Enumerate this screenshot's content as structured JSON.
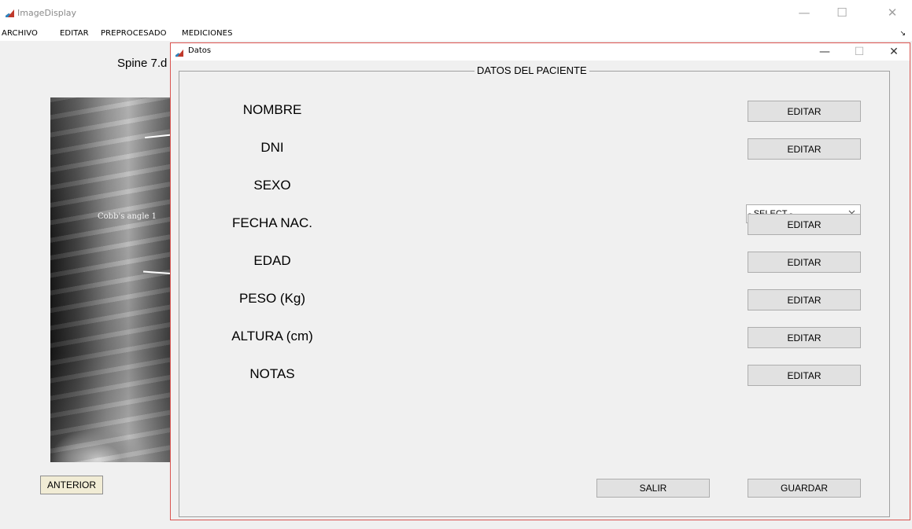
{
  "main_window": {
    "title": "ImageDisplay",
    "controls": {
      "minimize": "—",
      "maximize": "☐",
      "close": "✕"
    },
    "menu": [
      "ARCHIVO",
      "EDITAR",
      "PREPROCESADO",
      "MEDICIONES"
    ],
    "resize_mark": "↘",
    "image_title": "Spine 7.d",
    "xray_annotation": "Cobb's angle 1",
    "anterior_label": "ANTERIOR"
  },
  "dialog": {
    "title": "Datos",
    "controls": {
      "minimize": "—",
      "maximize": "☐",
      "close": "✕"
    },
    "panel_title": "DATOS DEL PACIENTE",
    "fields": [
      {
        "label": "NOMBRE",
        "button": "EDITAR"
      },
      {
        "label": "DNI",
        "button": "EDITAR"
      },
      {
        "label": "SEXO",
        "select_value": "- SELECT -"
      },
      {
        "label": "FECHA NAC.",
        "button": "EDITAR"
      },
      {
        "label": "EDAD",
        "button": "EDITAR"
      },
      {
        "label": "PESO (Kg)",
        "button": "EDITAR"
      },
      {
        "label": "ALTURA (cm)",
        "button": "EDITAR"
      },
      {
        "label": "NOTAS",
        "button": "EDITAR"
      }
    ],
    "salir_label": "SALIR",
    "guardar_label": "GUARDAR"
  },
  "colors": {
    "dialog_border": "#d9534f",
    "button_face": "#e1e1e1",
    "anterior_face": "#f1ecd5",
    "window_bg": "#f0f0f0"
  },
  "icons": [
    "matlab-icon",
    "chevron-down-icon"
  ]
}
